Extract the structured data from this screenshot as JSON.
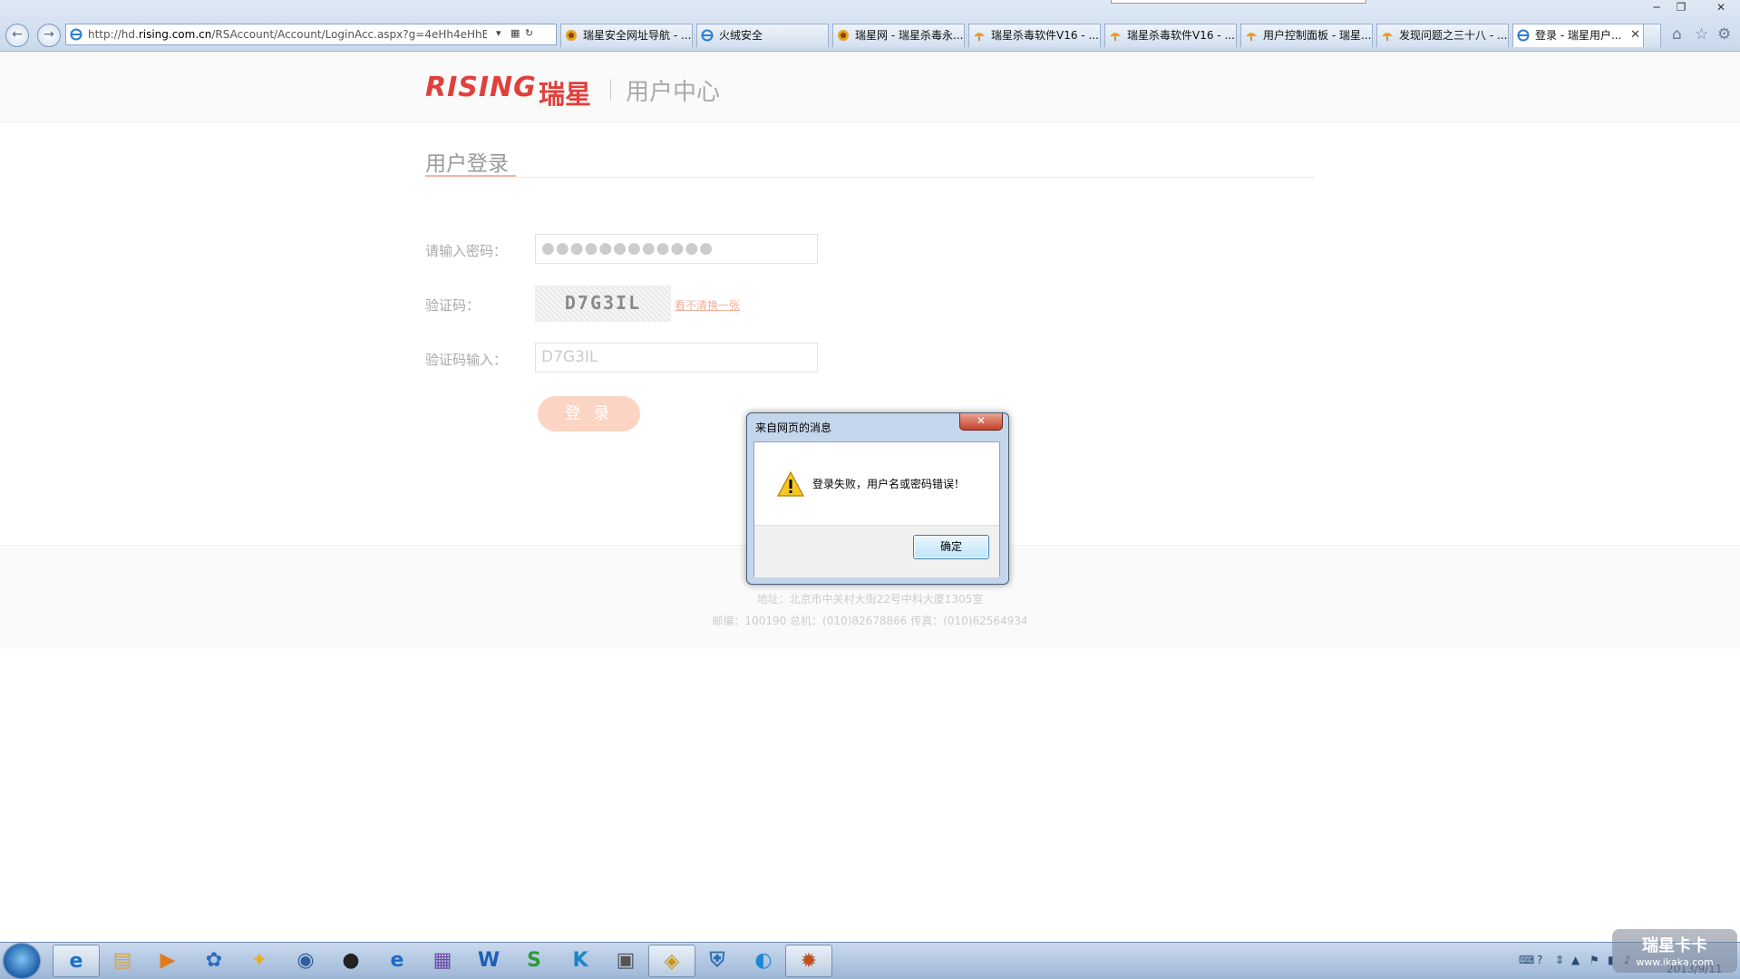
{
  "browser": {
    "url_prefix": "http://hd.",
    "url_domain": "rising.com.cn",
    "url_suffix": "/RSAccount/Account/LoginAcc.aspx?g=4eHh4eHhBRUZBh",
    "window_controls": {
      "minimize": "─",
      "maximize": "❐",
      "close": "✕"
    },
    "tabs": [
      {
        "label": "瑞星安全网址导航 - ...",
        "icon": "rising-lion-icon"
      },
      {
        "label": "火绒安全",
        "icon": "ie-icon"
      },
      {
        "label": "瑞星网 - 瑞星杀毒永...",
        "icon": "rising-lion-icon"
      },
      {
        "label": "瑞星杀毒软件V16 - ...",
        "icon": "rising-umbrella-icon"
      },
      {
        "label": "瑞星杀毒软件V16 - ...",
        "icon": "rising-umbrella-icon"
      },
      {
        "label": "用户控制面板 - 瑞星...",
        "icon": "rising-umbrella-icon"
      },
      {
        "label": "发现问题之三十八 - ...",
        "icon": "rising-umbrella-icon"
      },
      {
        "label": "登录 - 瑞星用户...",
        "icon": "ie-icon",
        "active": true
      }
    ],
    "tab_close": "✕"
  },
  "page": {
    "logo_text": "RISING",
    "logo_cn": "瑞星",
    "site_title": "用户中心",
    "login_heading": "用户登录",
    "password_label": "请输入密码：",
    "password_value": "●●●●●●●●●●●●",
    "captcha_label": "验证码：",
    "captcha_image_text": "D7G3IL",
    "refresh_captcha_link": "看不清换一张",
    "captcha_input_label": "验证码输入：",
    "captcha_input_value": "D7G3IL",
    "login_button": "登 录",
    "footer_address": "地址：北京市中关村大街22号中科大厦1305室",
    "footer_contact": "邮编：100190 总机：(010)82678866 传真：(010)62564934"
  },
  "dialog": {
    "title": "来自网页的消息",
    "message": "登录失败，用户名或密码错误！",
    "ok_button": "确定",
    "close": "✕",
    "icon": "warning-icon"
  },
  "taskbar": {
    "date": "2013/9/11",
    "pinned": [
      {
        "name": "ie-taskbar-button",
        "glyph": "e",
        "color": "#1e6fc4",
        "running": true
      },
      {
        "name": "explorer-taskbar-button",
        "glyph": "▤",
        "color": "#d9a441"
      },
      {
        "name": "media-player-taskbar-button",
        "glyph": "▶",
        "color": "#e07a1e"
      },
      {
        "name": "app-taskbar-button-1",
        "glyph": "✿",
        "color": "#2b6cc0"
      },
      {
        "name": "app-taskbar-button-2",
        "glyph": "✦",
        "color": "#e0b020"
      },
      {
        "name": "app-taskbar-button-3",
        "glyph": "◉",
        "color": "#2f5f9c"
      },
      {
        "name": "qq-taskbar-button",
        "glyph": "●",
        "color": "#222"
      },
      {
        "name": "browser-taskbar-button",
        "glyph": "e",
        "color": "#1b6bc8"
      },
      {
        "name": "archive-taskbar-button",
        "glyph": "▦",
        "color": "#6c4aa8"
      },
      {
        "name": "word-taskbar-button",
        "glyph": "W",
        "color": "#1f5fb8"
      },
      {
        "name": "spreadsheet-taskbar-button",
        "glyph": "S",
        "color": "#2e9a3a"
      },
      {
        "name": "k-app-taskbar-button",
        "glyph": "K",
        "color": "#1a86c8"
      },
      {
        "name": "calendar-taskbar-button",
        "glyph": "▣",
        "color": "#555"
      },
      {
        "name": "rising-antivirus-taskbar-button",
        "glyph": "◈",
        "color": "#c8961c",
        "running": true
      },
      {
        "name": "security-shield-taskbar-button",
        "glyph": "⛨",
        "color": "#2d6db3"
      },
      {
        "name": "app-taskbar-button-4",
        "glyph": "◐",
        "color": "#1a8ad6"
      },
      {
        "name": "game-taskbar-button",
        "glyph": "✹",
        "color": "#c0501e",
        "running": true
      }
    ]
  },
  "watermark": {
    "title": "瑞星卡卡",
    "url": "www.ikaka.com"
  }
}
